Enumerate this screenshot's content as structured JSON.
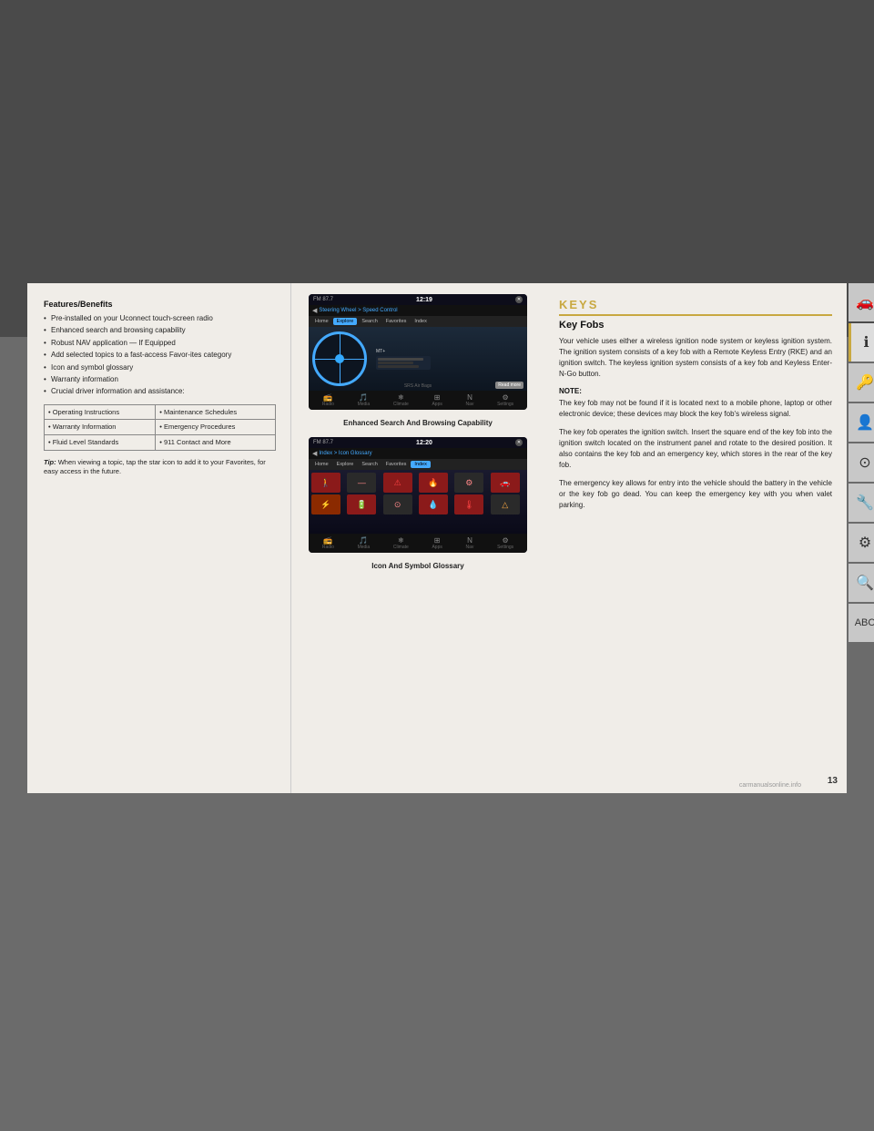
{
  "page": {
    "number": "13",
    "background_color": "#6b6b6b"
  },
  "left_column": {
    "features_title": "Features/Benefits",
    "bullets": [
      "Pre-installed on your Uconnect touch-screen radio",
      "Enhanced search and browsing capability",
      "Robust NAV application — If Equipped",
      "Add selected topics to a fast-access Favor-ites category",
      "Icon and symbol glossary",
      "Warranty information",
      "Crucial driver information and assistance:"
    ],
    "table": {
      "rows": [
        [
          "Operating Instructions",
          "Maintenance Schedules"
        ],
        [
          "Warranty Information",
          "Emergency Procedures"
        ],
        [
          "Fluid Level Standards",
          "911 Contact and More"
        ]
      ]
    },
    "tip": {
      "label": "Tip:",
      "text": "When viewing a topic, tap the star icon to add it to your Favorites, for easy access in the future."
    }
  },
  "middle_column": {
    "screen1": {
      "fm": "FM 87.7",
      "time": "12:19",
      "breadcrumb": "Steering Wheel > Speed Control",
      "tabs": [
        "Home",
        "Explore",
        "Search",
        "Favorites",
        "Index"
      ],
      "active_tab": "Explore",
      "caption": "Enhanced Search And Browsing Capability"
    },
    "screen2": {
      "fm": "FM 87.7",
      "time": "12:20",
      "breadcrumb": "Index > Icon Glossary",
      "tabs": [
        "Home",
        "Explore",
        "Search",
        "Favorites",
        "Index"
      ],
      "active_tab": "Index",
      "caption": "Icon And Symbol Glossary"
    }
  },
  "right_column": {
    "section_heading": "KEYS",
    "subsection_heading": "Key Fobs",
    "paragraphs": [
      "Your vehicle uses either a wireless ignition node system or keyless ignition system. The ignition system consists of a key fob with a Remote Keyless Entry (RKE) and an ignition switch. The keyless ignition system consists of a key fob and Keyless Enter-N-Go button.",
      "The key fob may not be found if it is located next to a mobile phone, laptop or other electronic device; these devices may block the key fob's wireless signal.",
      "The key fob operates the ignition switch. Insert the square end of the key fob into the ignition switch located on the instrument panel and rotate to the desired position. It also contains the key fob and an emergency key, which stores in the rear of the key fob.",
      "The emergency key allows for entry into the vehicle should the battery in the vehicle or the key fob go dead. You can keep the emergency key with you when valet parking."
    ],
    "note_label": "NOTE:"
  },
  "side_tabs": [
    {
      "icon": "🚗",
      "label": "car"
    },
    {
      "icon": "ℹ",
      "label": "info",
      "active": true
    },
    {
      "icon": "🔑",
      "label": "key"
    },
    {
      "icon": "👤",
      "label": "person"
    },
    {
      "icon": "🔧",
      "label": "tools"
    },
    {
      "icon": "⚙",
      "label": "gear1"
    },
    {
      "icon": "🔩",
      "label": "gear2"
    },
    {
      "icon": "🔍",
      "label": "search"
    },
    {
      "icon": "🔤",
      "label": "abc"
    }
  ],
  "watermark": "carmanualsonline.info"
}
